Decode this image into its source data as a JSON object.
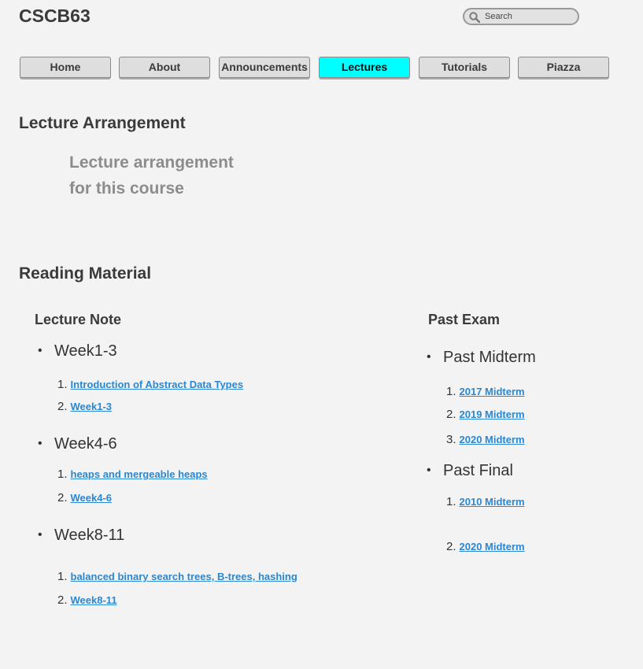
{
  "site": {
    "title": "CSCB63"
  },
  "search": {
    "placeholder": "Search",
    "value": ""
  },
  "nav": [
    {
      "label": "Home",
      "active": false
    },
    {
      "label": "About",
      "active": false
    },
    {
      "label": "Announcements",
      "active": false
    },
    {
      "label": "Lectures",
      "active": true
    },
    {
      "label": "Tutorials",
      "active": false
    },
    {
      "label": "Piazza",
      "active": false
    }
  ],
  "colors": {
    "active_tab": "#00ffff",
    "link": "#2b87d1",
    "background": "#f3f3f3"
  },
  "icons": {
    "search": "search-icon"
  },
  "lecture_arrangement": {
    "heading": "Lecture Arrangement",
    "text_line1": "Lecture arrangement",
    "text_line2": "for this course"
  },
  "reading_material": {
    "heading": "Reading Material",
    "lecture_note": {
      "title": "Lecture Note",
      "weeks": [
        {
          "label": "Week1-3",
          "items": [
            {
              "num": "1.",
              "text": "Introduction of Abstract Data Types"
            },
            {
              "num": "2.",
              "text": "Week1-3"
            }
          ]
        },
        {
          "label": "Week4-6",
          "items": [
            {
              "num": "1.",
              "text": "heaps and mergeable heaps"
            },
            {
              "num": "2.",
              "text": "Week4-6"
            }
          ]
        },
        {
          "label": "Week8-11",
          "items": [
            {
              "num": "1.",
              "text": "balanced binary search trees, B-trees, hashing"
            },
            {
              "num": "2.",
              "text": "Week8-11"
            }
          ]
        }
      ]
    },
    "past_exam": {
      "title": "Past Exam",
      "groups": [
        {
          "label": "Past Midterm",
          "items": [
            {
              "num": "1.",
              "text": "2017 Midterm"
            },
            {
              "num": "2.",
              "text": "2019 Midterm"
            },
            {
              "num": "3.",
              "text": "2020 Midterm"
            }
          ]
        },
        {
          "label": "Past Final",
          "items": [
            {
              "num": "1.",
              "text": "2010 Midterm"
            },
            {
              "num": "2.",
              "text": "2020 Midterm"
            }
          ]
        }
      ]
    }
  }
}
